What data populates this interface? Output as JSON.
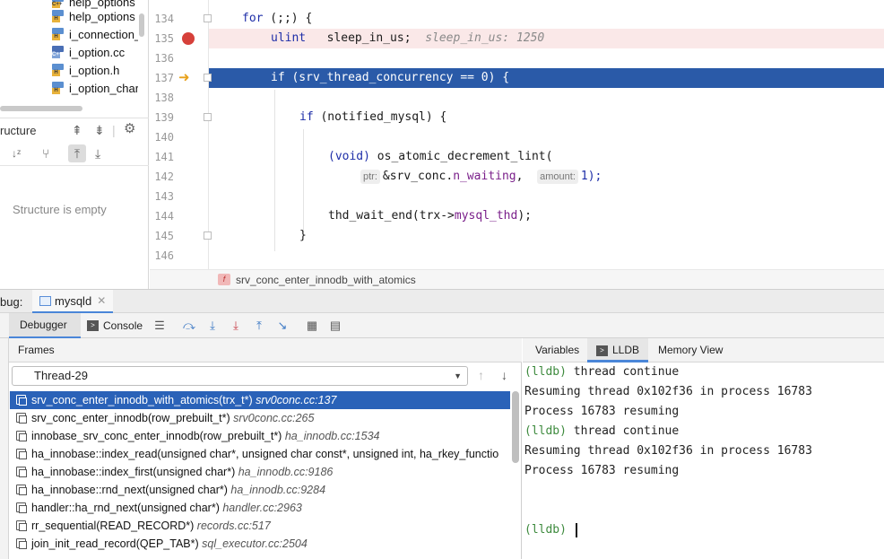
{
  "project_tree": {
    "items": [
      {
        "label": "help_options",
        "icon": "header-file-icon"
      },
      {
        "label": "help_options",
        "icon": "header-file-icon"
      },
      {
        "label": "i_connection_",
        "icon": "header-file-icon"
      },
      {
        "label": "i_option.cc",
        "icon": "cpp-file-icon"
      },
      {
        "label": "i_option.h",
        "icon": "header-file-icon"
      },
      {
        "label": "i_option_char",
        "icon": "header-file-icon"
      }
    ]
  },
  "structure": {
    "title": "ructure",
    "empty_text": "Structure is empty"
  },
  "editor": {
    "lines": [
      {
        "num": "134"
      },
      {
        "num": "135"
      },
      {
        "num": "136"
      },
      {
        "num": "137"
      },
      {
        "num": "138"
      },
      {
        "num": "139"
      },
      {
        "num": "140"
      },
      {
        "num": "141"
      },
      {
        "num": "142"
      },
      {
        "num": "143"
      },
      {
        "num": "144"
      },
      {
        "num": "145"
      },
      {
        "num": "146"
      }
    ],
    "code": {
      "l134_kw": "for",
      "l134_rest": " (;;) {",
      "l135_type": "ulint",
      "l135_rest": "   sleep_in_us;",
      "l135_inline": "sleep_in_us: 1250",
      "l137": "if (srv_thread_concurrency == 0) {",
      "l139_kw": "if",
      "l139_rest": " (notified_mysql) {",
      "l141_kw": "(void)",
      "l141_rest": " os_atomic_decrement_lint(",
      "l142_hint1": "ptr:",
      "l142_a": "&srv_conc.",
      "l142_field": "n_waiting",
      "l142_b": ",  ",
      "l142_hint2": "amount:",
      "l142_c": "1);",
      "l144_a": "thd_wait_end(trx->",
      "l144_field": "mysql_thd",
      "l144_b": ");",
      "l145": "}"
    },
    "breadcrumb": "srv_conc_enter_innodb_with_atomics",
    "breadcrumb_icon": "f"
  },
  "debug": {
    "label": "bug:",
    "session_tab": "mysqld",
    "toolbar": {
      "debugger_tab": "Debugger",
      "console_tab": "Console"
    },
    "frames_header": "Frames",
    "thread": "Thread-29",
    "frames": [
      {
        "fn": "srv_conc_enter_innodb_with_atomics(trx_t*)",
        "loc": "srv0conc.cc:137",
        "selected": true
      },
      {
        "fn": "srv_conc_enter_innodb(row_prebuilt_t*)",
        "loc": "srv0conc.cc:265",
        "selected": false
      },
      {
        "fn": "innobase_srv_conc_enter_innodb(row_prebuilt_t*)",
        "loc": "ha_innodb.cc:1534",
        "selected": false
      },
      {
        "fn": "ha_innobase::index_read(unsigned char*, unsigned char const*, unsigned int, ha_rkey_functio",
        "loc": "",
        "selected": false
      },
      {
        "fn": "ha_innobase::index_first(unsigned char*)",
        "loc": "ha_innodb.cc:9186",
        "selected": false
      },
      {
        "fn": "ha_innobase::rnd_next(unsigned char*)",
        "loc": "ha_innodb.cc:9284",
        "selected": false
      },
      {
        "fn": "handler::ha_rnd_next(unsigned char*)",
        "loc": "handler.cc:2963",
        "selected": false
      },
      {
        "fn": "rr_sequential(READ_RECORD*)",
        "loc": "records.cc:517",
        "selected": false
      },
      {
        "fn": "join_init_read_record(QEP_TAB*)",
        "loc": "sql_executor.cc:2504",
        "selected": false
      }
    ],
    "right_tabs": {
      "variables": "Variables",
      "lldb": "LLDB",
      "memory": "Memory View"
    },
    "console": {
      "l1_prompt": "(lldb)",
      "l1_cmd": " thread continue",
      "l2": "Resuming thread 0x102f36 in process 16783",
      "l3": "Process 16783 resuming",
      "l4_prompt": "(lldb)",
      "l4_cmd": " thread continue",
      "l5": "Resuming thread 0x102f36 in process 16783",
      "l6": "Process 16783 resuming",
      "input_prompt": "(lldb)"
    }
  },
  "colors": {
    "selection": "#2a5aa8",
    "breakpoint_line": "#fae8e8",
    "breakpoint": "#d6403a",
    "exec_arrow": "#e8a21d",
    "lldb_prompt": "#3d8a3d"
  }
}
